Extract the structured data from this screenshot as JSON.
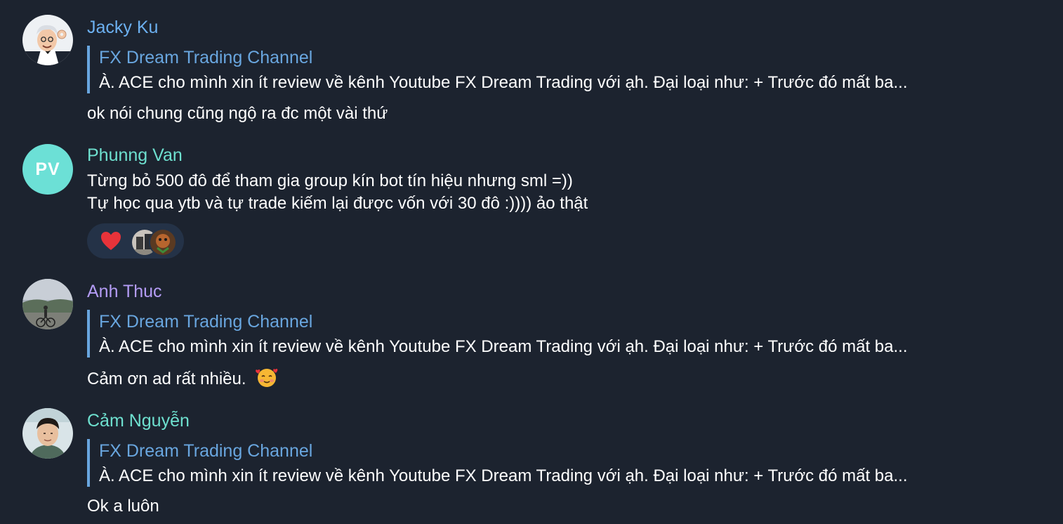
{
  "messages": [
    {
      "sender": "Jacky Ku",
      "sender_color": "#6cb0f0",
      "avatar_icon": "jacky-avatar-illustration",
      "reply": {
        "title": "FX Dream Trading Channel",
        "text": "À. ACE cho mình xin ít review về kênh Youtube FX Dream Trading với ạh.  Đại loại như:  + Trước đó mất ba..."
      },
      "text": "ok nói chung cũng ngộ ra đc một vài thứ"
    },
    {
      "sender": "Phunng Van",
      "sender_color": "#6ee0cf",
      "avatar_initials": "PV",
      "avatar_color": "#6ce0d6",
      "text_lines": [
        "Từng bỏ 500 đô để tham gia group kín bot tín hiệu nhưng sml =))",
        "Tự học qua ytb và tự trade kiếm lại được vốn với 30 đô :)))) ảo thật"
      ],
      "reaction": {
        "emoji": "heart-icon",
        "reactors": [
          "reactor-avatar-1",
          "reactor-avatar-2"
        ]
      }
    },
    {
      "sender": "Anh Thuc",
      "sender_color": "#b49cf5",
      "avatar_icon": "anh-thuc-avatar-photo",
      "reply": {
        "title": "FX Dream Trading Channel",
        "text": "À. ACE cho mình xin ít review về kênh Youtube FX Dream Trading với ạh.  Đại loại như:  + Trước đó mất ba..."
      },
      "text": "Cảm ơn ad rất nhiều.",
      "text_emoji": "smiling-face-with-hearts-icon"
    },
    {
      "sender": "Cảm Nguyễn",
      "sender_color": "#6ee0cf",
      "avatar_icon": "cam-nguyen-avatar-photo",
      "reply": {
        "title": "FX Dream Trading Channel",
        "text": "À. ACE cho mình xin ít review về kênh Youtube FX Dream Trading với ạh.  Đại loại như:  + Trước đó mất ba..."
      },
      "text": "Ok a luôn"
    }
  ],
  "colors": {
    "background": "#1c232f",
    "reply_accent": "#69a6df",
    "reaction_bg": "#243247",
    "heart": "#e8333a"
  }
}
